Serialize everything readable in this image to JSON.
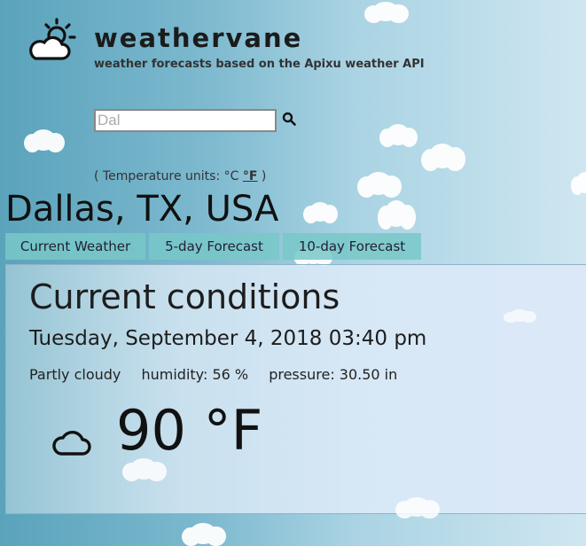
{
  "header": {
    "brand": "weathervane",
    "tagline": "weather forecasts based on the Apixu weather API",
    "logo_icon": "partly-cloudy-day-icon"
  },
  "search": {
    "value": "Dal",
    "button_icon": "search-icon"
  },
  "units": {
    "prefix": "( Temperature units: ",
    "celsius": "°C",
    "fahrenheit": "°F",
    "suffix": " )",
    "selected": "°F"
  },
  "location": "Dallas, TX, USA",
  "tabs": [
    {
      "label": "Current Weather"
    },
    {
      "label": "5-day Forecast"
    },
    {
      "label": "10-day Forecast"
    }
  ],
  "current": {
    "title": "Current conditions",
    "datetime": "Tuesday, September 4, 2018 03:40 pm",
    "condition": "Partly cloudy",
    "humidity": "humidity: 56 %",
    "pressure": "pressure: 30.50 in",
    "temperature": "90 °F",
    "condition_icon": "cloud-icon"
  },
  "colors": {
    "background_left": "#5aa3bb",
    "background_right": "#cfe6f1",
    "tab_bg": "#78c8c8"
  }
}
